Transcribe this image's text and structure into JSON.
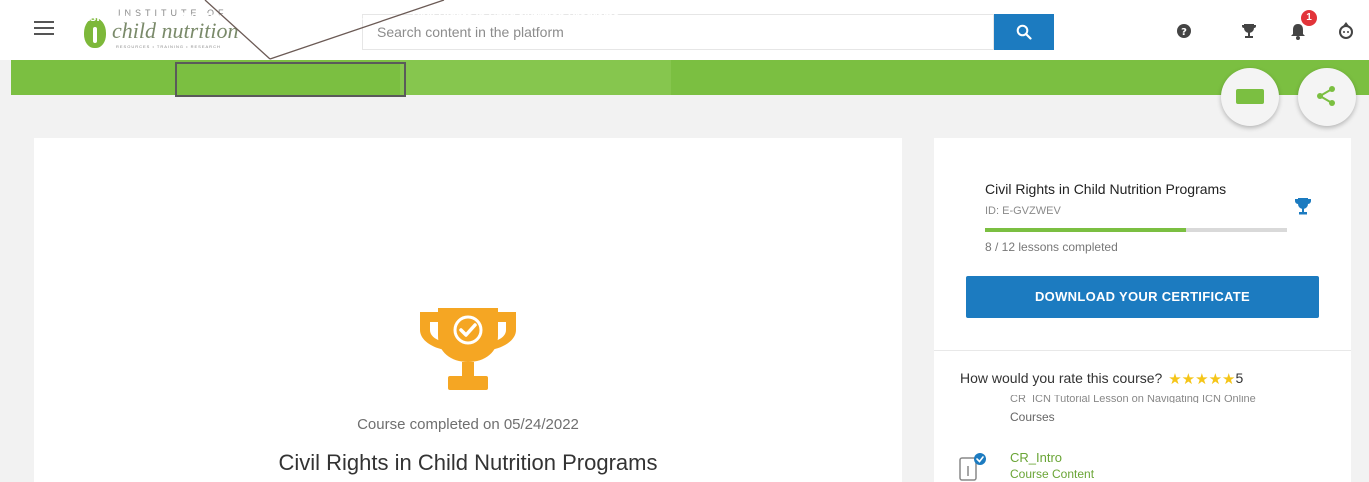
{
  "header": {
    "logo_top": "INSTITUTE OF",
    "logo_main": "child nutrition",
    "logo_sub": "RESOURCES • TRAINING • RESEARCH",
    "search_placeholder": "Search content in the platform",
    "notification_count": "1"
  },
  "breadcrumb": {
    "items": [
      {
        "label": "iLearn Dashboard"
      },
      {
        "label": "My Courses and Learning Plans"
      },
      {
        "label": "Civil Rights in Child Nutrition Programs"
      }
    ],
    "separator": "›"
  },
  "main": {
    "completed_text": "Course completed on 05/24/2022",
    "course_title": "Civil Rights in Child Nutrition Programs"
  },
  "sidebar": {
    "course_title": "Civil Rights in Child Nutrition Programs",
    "course_id": "ID: E-GVZWEV",
    "progress_fraction": 0.667,
    "lessons_completed": "8 / 12 lessons completed",
    "certificate_button": "DOWNLOAD YOUR CERTIFICATE",
    "rate_question": "How would you rate this course?",
    "rating_value": "5",
    "stars": [
      "★",
      "★",
      "★",
      "★",
      "★"
    ],
    "clipped_item_text": "CR_ICN Tutorial Lesson on Navigating ICN Online",
    "clipped_item_sub": "Courses",
    "content_item": {
      "title": "CR_Intro",
      "type": "Course Content"
    }
  },
  "colors": {
    "brand_green": "#7bbf41",
    "primary_blue": "#1c7bc0",
    "trophy_orange": "#f5a623",
    "star_gold": "#f5c518",
    "badge_red": "#e2343a"
  }
}
